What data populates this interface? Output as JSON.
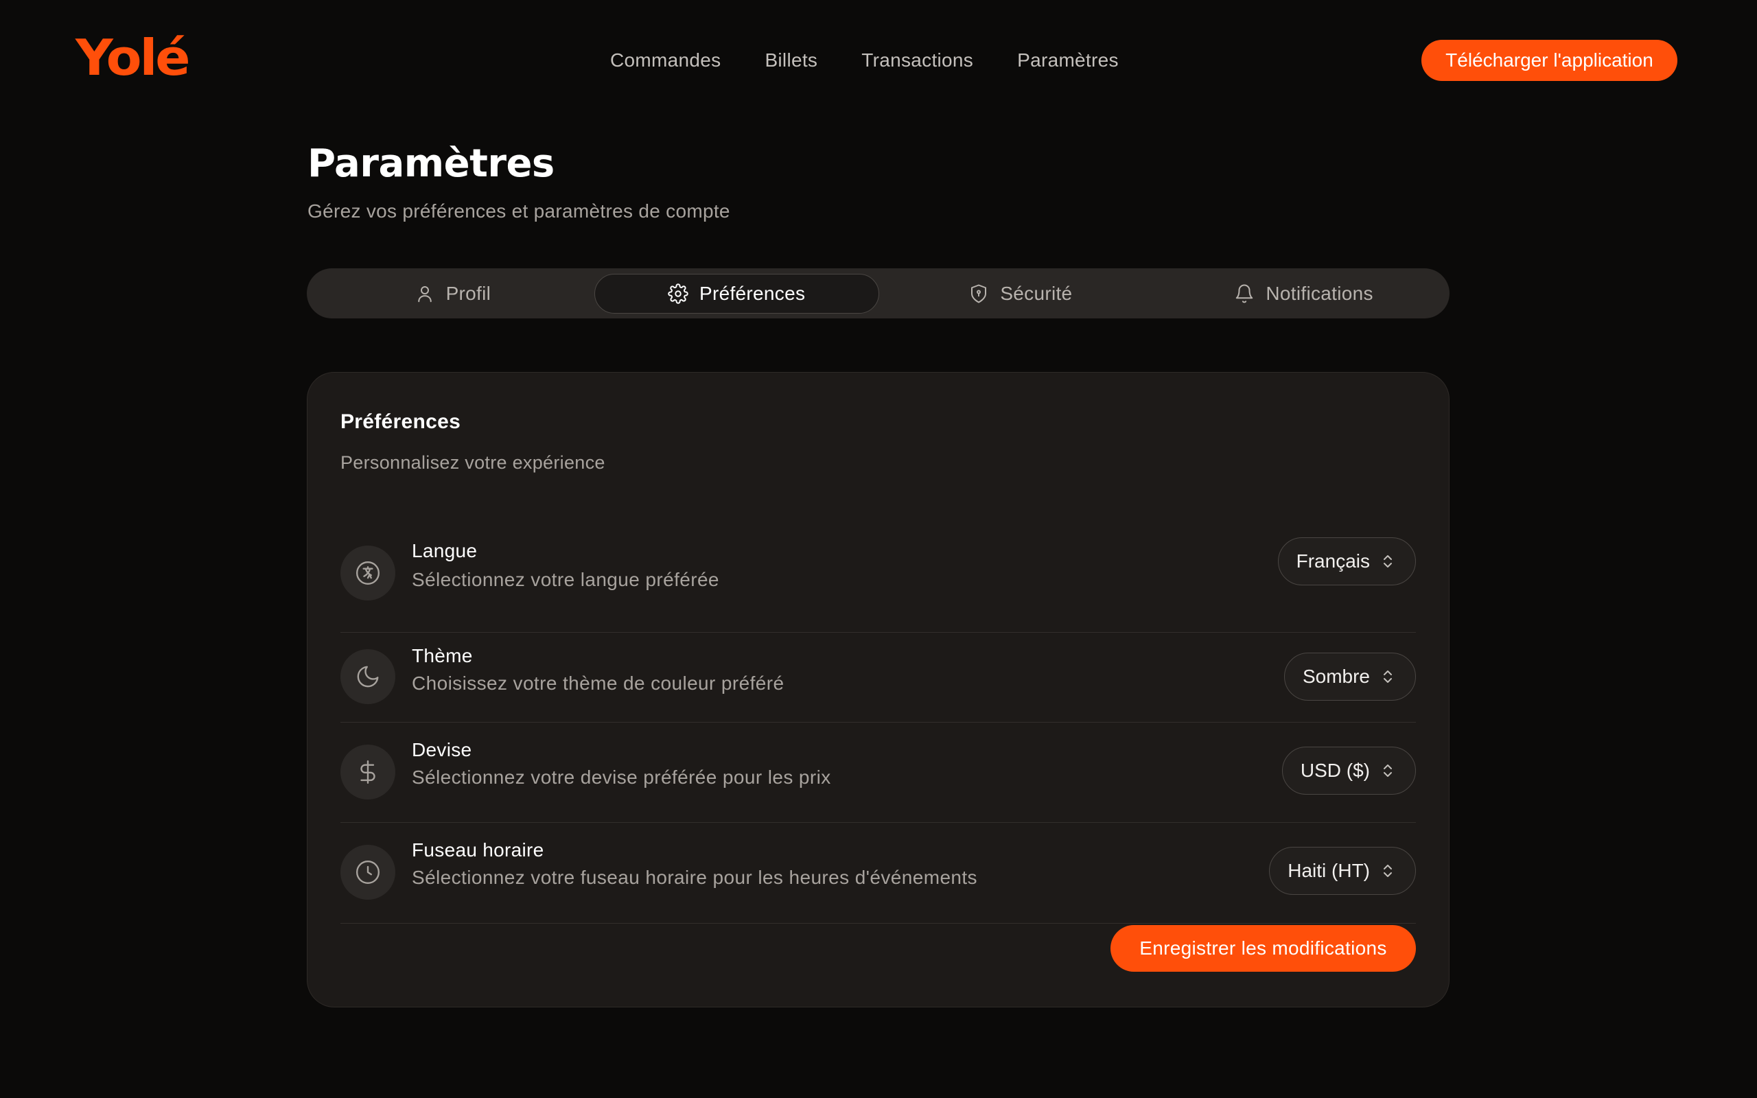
{
  "brand": {
    "logo": "Yolé",
    "accent": "#ff4f0a"
  },
  "nav": {
    "items": [
      "Commandes",
      "Billets",
      "Transactions",
      "Paramètres"
    ],
    "download_label": "Télécharger l'application"
  },
  "page": {
    "title": "Paramètres",
    "subtitle": "Gérez vos préférences et paramètres de compte"
  },
  "tabs": [
    {
      "label": "Profil",
      "icon": "user-icon"
    },
    {
      "label": "Préférences",
      "icon": "gear-icon",
      "active": true
    },
    {
      "label": "Sécurité",
      "icon": "shield-icon"
    },
    {
      "label": "Notifications",
      "icon": "bell-icon"
    }
  ],
  "card": {
    "title": "Préférences",
    "subtitle": "Personnalisez votre expérience",
    "rows": [
      {
        "label": "Langue",
        "description": "Sélectionnez votre langue préférée",
        "value": "Français",
        "icon": "language-icon"
      },
      {
        "label": "Thème",
        "description": "Choisissez votre thème de couleur préféré",
        "value": "Sombre",
        "icon": "moon-icon"
      },
      {
        "label": "Devise",
        "description": "Sélectionnez votre devise préférée pour les prix",
        "value": "USD ($)",
        "icon": "dollar-icon"
      },
      {
        "label": "Fuseau horaire",
        "description": "Sélectionnez votre fuseau horaire pour les heures d'événements",
        "value": "Haiti (HT)",
        "icon": "clock-icon"
      }
    ],
    "save_label": "Enregistrer les modifications"
  }
}
